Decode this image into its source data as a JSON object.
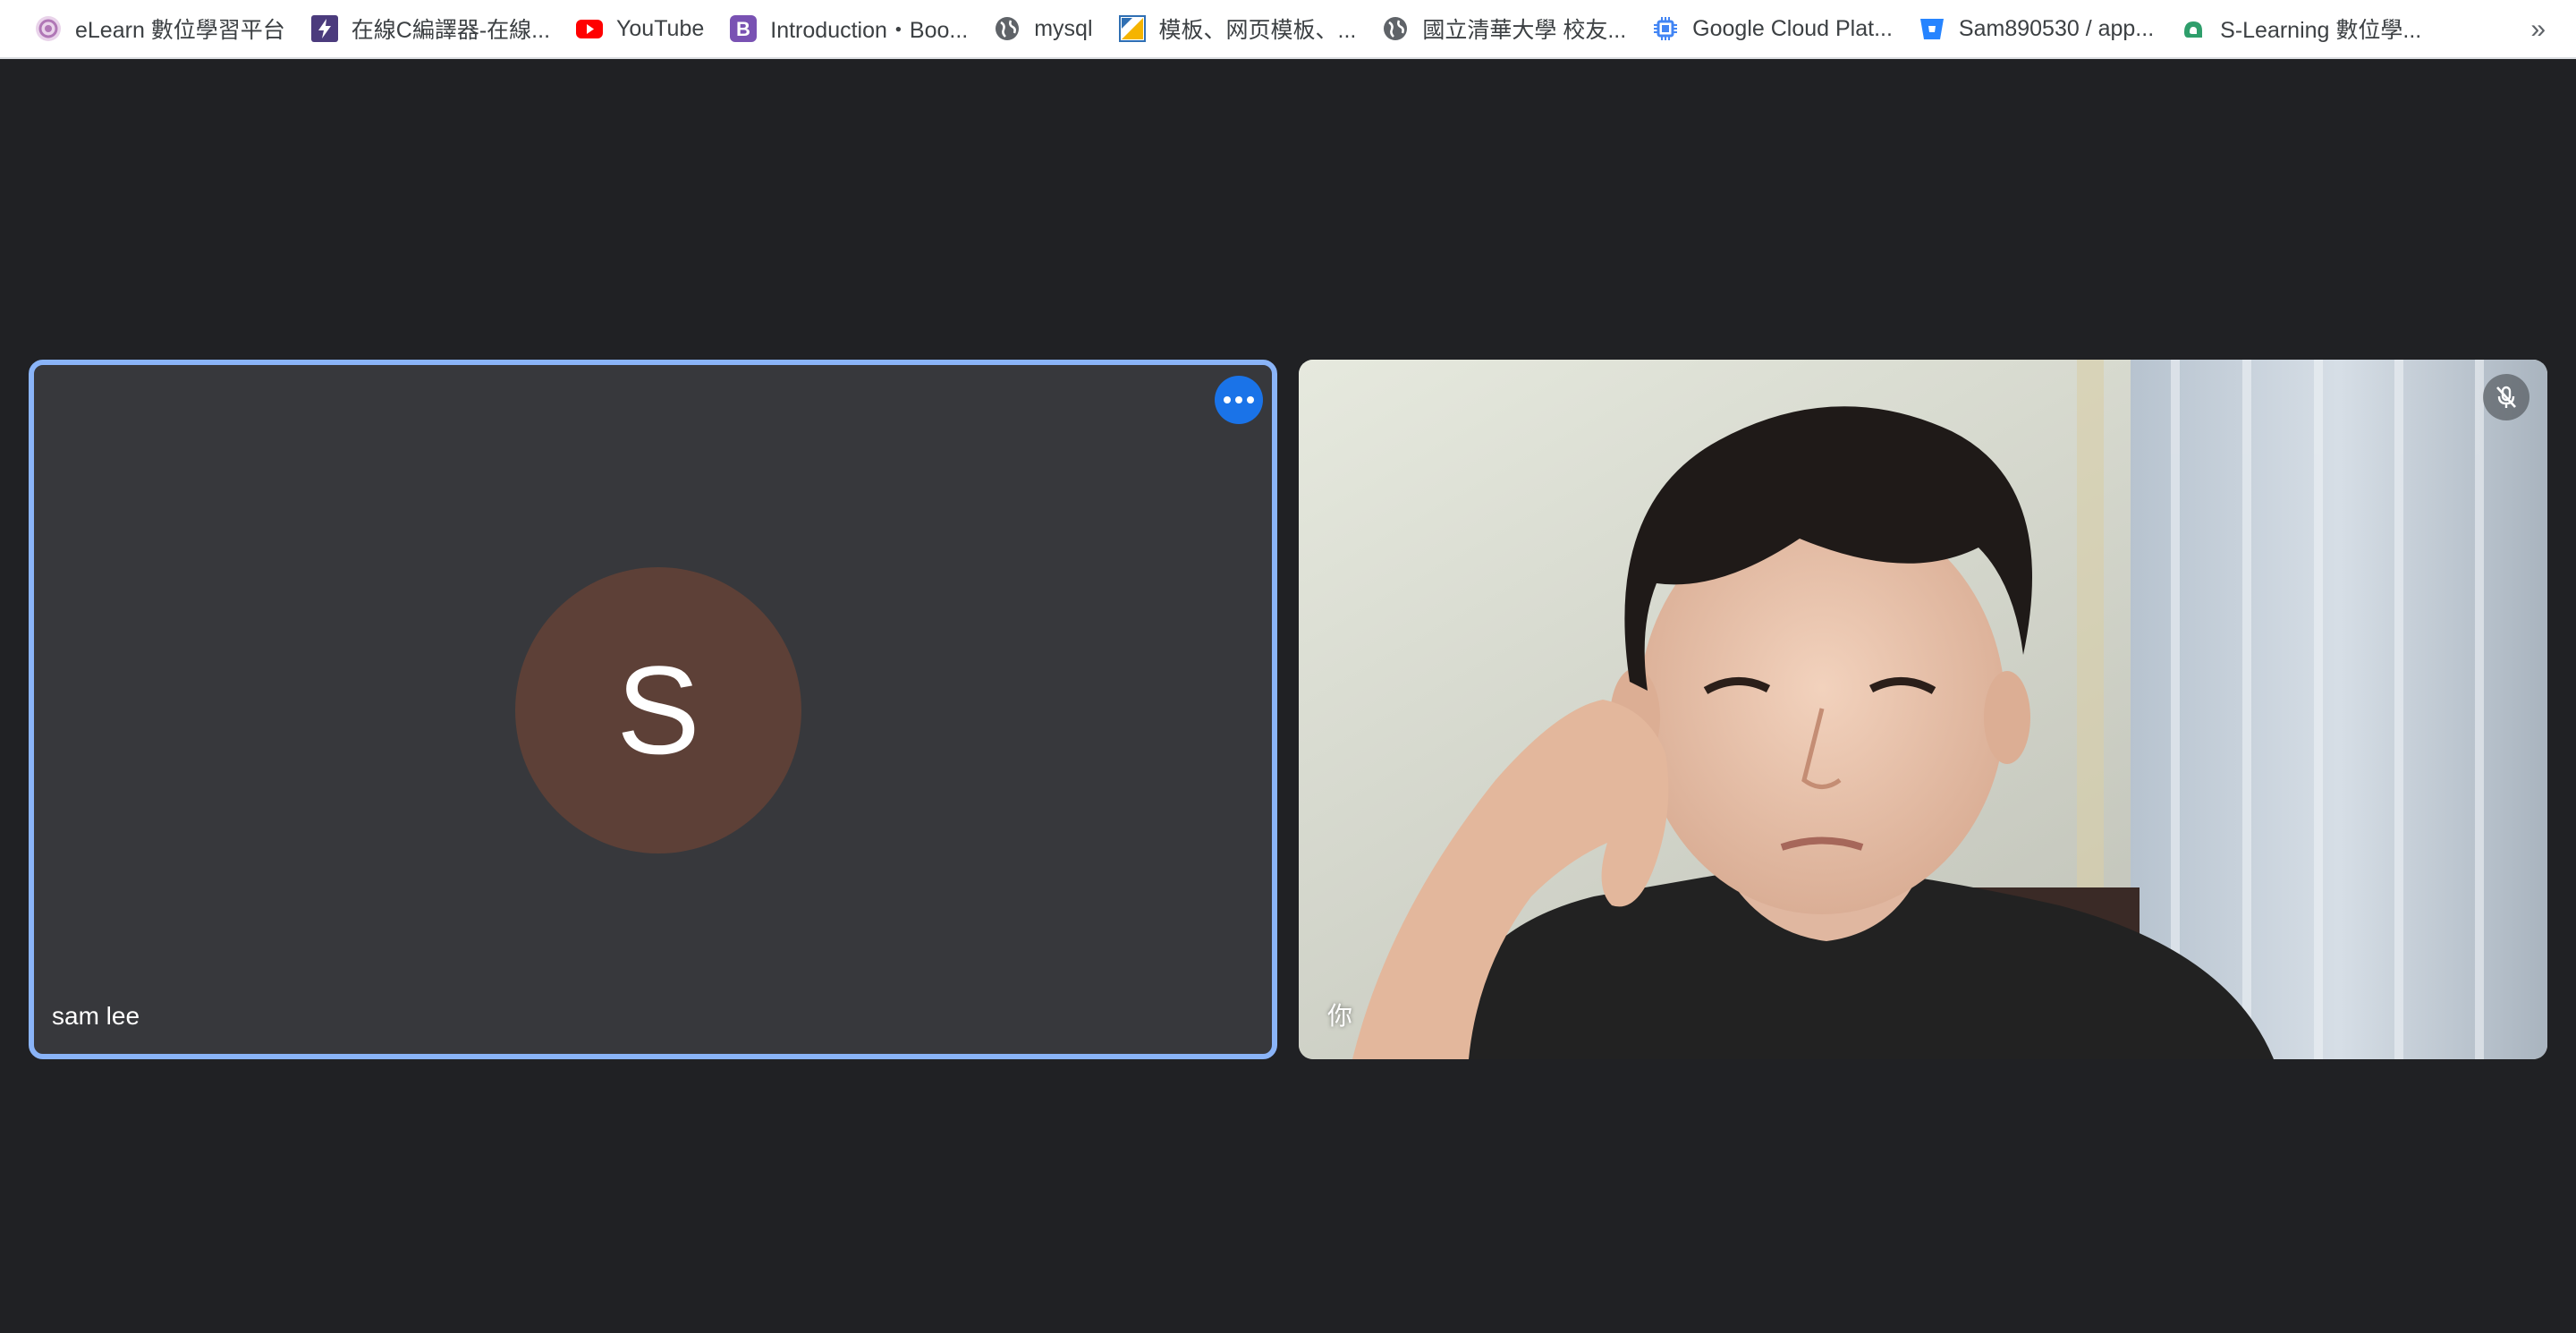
{
  "bookmarks": [
    {
      "label": "eLearn 數位學習平台",
      "icon": "elearn-icon"
    },
    {
      "label": "在線C編譯器-在線...",
      "icon": "bolt-icon"
    },
    {
      "label": "YouTube",
      "icon": "youtube-icon"
    },
    {
      "label": "Introduction・Boo...",
      "icon": "bootstrap-icon"
    },
    {
      "label": "mysql",
      "icon": "globe-icon"
    },
    {
      "label": "模板、网页模板、...",
      "icon": "template-icon"
    },
    {
      "label": "國立清華大學 校友...",
      "icon": "globe-icon"
    },
    {
      "label": "Google Cloud Plat...",
      "icon": "google-cloud-icon"
    },
    {
      "label": "Sam890530 / app...",
      "icon": "bitbucket-icon"
    },
    {
      "label": "S-Learning 數位學...",
      "icon": "slearning-icon"
    }
  ],
  "bookmarks_overflow": "»",
  "participants": {
    "remote": {
      "name": "sam lee",
      "initial": "S",
      "avatar_color": "#5d4037",
      "speaking_border": "#8ab4f8"
    },
    "self": {
      "name": "你",
      "mic": "muted"
    }
  },
  "colors": {
    "background": "#202124",
    "tile": "#37383c",
    "accent": "#1a73e8"
  }
}
